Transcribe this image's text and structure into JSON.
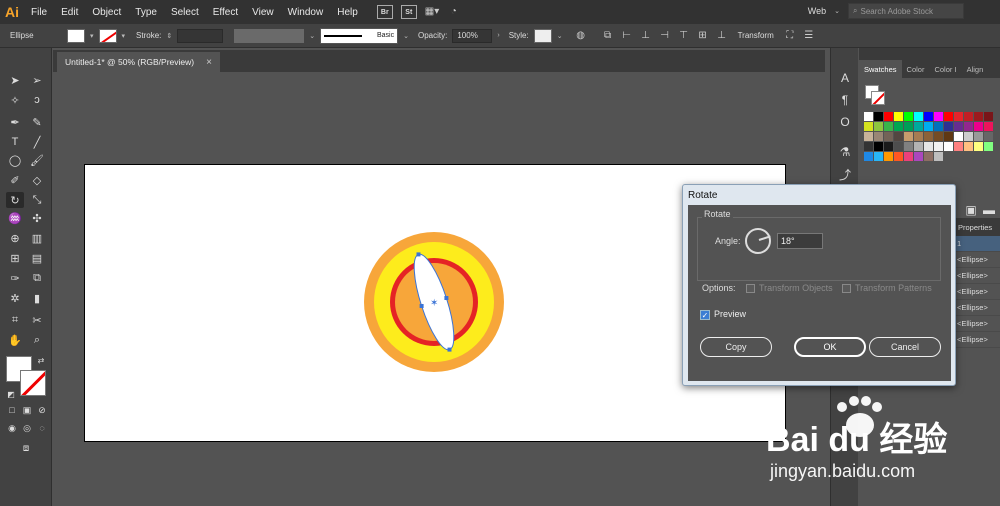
{
  "app": {
    "logo": "Ai"
  },
  "menu": [
    "File",
    "Edit",
    "Object",
    "Type",
    "Select",
    "Effect",
    "View",
    "Window",
    "Help"
  ],
  "menu_badges": [
    "Br",
    "St"
  ],
  "workspace": {
    "label": "Web",
    "search_placeholder": "Search Adobe Stock"
  },
  "control": {
    "selection_label": "Ellipse",
    "stroke_label": "Stroke:",
    "brush_label": "Basic",
    "opacity_label": "Opacity:",
    "opacity_value": "100%",
    "style_label": "Style:",
    "transform_label": "Transform"
  },
  "document": {
    "tab_title": "Untitled-1* @ 50% (RGB/Preview)",
    "close": "×"
  },
  "swatches_panel": {
    "tabs": [
      "Swatches",
      "Color",
      "Color I",
      "Align"
    ],
    "colors": [
      "#ffffff",
      "#000000",
      "#ff0000",
      "#ffff00",
      "#00ff00",
      "#00ffff",
      "#0000ff",
      "#ff00ff",
      "#ff0000",
      "#e5242b",
      "#c11f25",
      "#9c1a1e",
      "#7a1519",
      "#d4e21f",
      "#8dc63f",
      "#3ab54a",
      "#00a651",
      "#009e58",
      "#00a99d",
      "#00aeef",
      "#0072bc",
      "#2e3192",
      "#662d91",
      "#92278f",
      "#ec008c",
      "#ed145b",
      "#c7b299",
      "#998675",
      "#736357",
      "#534741",
      "#c69c6d",
      "#a67c52",
      "#8c6239",
      "#754c24",
      "#603813",
      "#ffffff",
      "#cccccc",
      "#999999",
      "#666666",
      "#333333",
      "#000000",
      "#1a1a1a",
      "#4d4d4d",
      "#808080",
      "#b3b3b3",
      "#e6e6e6",
      "#f2f2f2",
      "#ffffff",
      "#ff8080",
      "#ffbf80",
      "#ffff80",
      "#80ff80",
      "#1e88e5",
      "#29b6f6",
      "#ff9800",
      "#ff5722",
      "#ec407a",
      "#ab47bc",
      "#8d6e63",
      "#bdbdbd"
    ]
  },
  "layers_panel": {
    "tab_label": "Properties",
    "rows": [
      "1",
      "<Ellipse>",
      "<Ellipse>",
      "<Ellipse>",
      "<Ellipse>",
      "<Ellipse>",
      "<Ellipse>"
    ]
  },
  "rotate_dialog": {
    "title": "Rotate",
    "group_title": "Rotate",
    "angle_label": "Angle:",
    "angle_value": "18°",
    "options_label": "Options:",
    "transform_objects": "Transform Objects",
    "transform_patterns": "Transform Patterns",
    "preview_label": "Preview",
    "copy_label": "Copy",
    "ok_label": "OK",
    "cancel_label": "Cancel"
  },
  "artwork": {
    "outer_color": "#f7a63a",
    "yellow_color": "#fdec1c",
    "red_color": "#e52325",
    "inner_color": "#f7a63a",
    "leaf_color": "#ffffff",
    "selection_color": "#3a73d6"
  },
  "watermark": {
    "text": "jingyan.baidu.com",
    "brand": "Bai du 经验"
  }
}
